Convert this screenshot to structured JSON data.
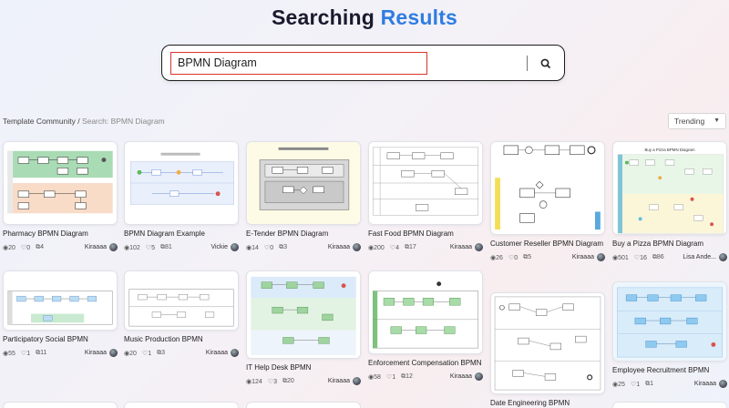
{
  "header": {
    "title_part1": "Searching",
    "title_part2": "Results"
  },
  "search": {
    "value": "BPMN Diagram",
    "button": "search-icon"
  },
  "breadcrumb": {
    "root": "Template Community",
    "separator": " / ",
    "current": "Search: BPMN Diagram"
  },
  "sort": {
    "selected": "Trending",
    "icon": "chevron-down-icon"
  },
  "colors": {
    "accent": "#2f7de1",
    "search_border": "#d9342b",
    "title": "#1a1a2e"
  },
  "cards": [
    {
      "title": "Pharmacy BPMN Diagram",
      "views": "20",
      "likes": "0",
      "copies": "4",
      "author": "Kiraaaa"
    },
    {
      "title": "BPMN Diagram Example",
      "views": "102",
      "likes": "5",
      "copies": "81",
      "author": "Vickie"
    },
    {
      "title": "E-Tender BPMN Diagram",
      "views": "14",
      "likes": "0",
      "copies": "3",
      "author": "Kiraaaa"
    },
    {
      "title": "Fast Food BPMN Diagram",
      "views": "200",
      "likes": "4",
      "copies": "17",
      "author": "Kiraaaa"
    },
    {
      "title": "Customer Reseller BPMN Diagram",
      "views": "26",
      "likes": "0",
      "copies": "5",
      "author": "Kiraaaa"
    },
    {
      "title": "Buy a Pizza BPMN Diagram",
      "views": "501",
      "likes": "16",
      "copies": "86",
      "author": "Lisa Ande..."
    },
    {
      "title": "Participatory Social BPMN",
      "views": "55",
      "likes": "1",
      "copies": "11",
      "author": "Kiraaaa"
    },
    {
      "title": "Music Production BPMN",
      "views": "20",
      "likes": "1",
      "copies": "3",
      "author": "Kiraaaa"
    },
    {
      "title": "IT Help Desk BPMN",
      "views": "124",
      "likes": "3",
      "copies": "20",
      "author": "Kiraaaa"
    },
    {
      "title": "Enforcement Compensation BPMN",
      "views": "58",
      "likes": "1",
      "copies": "12",
      "author": "Kiraaaa"
    },
    {
      "title": "Date Engineering BPMN",
      "views": "",
      "likes": "",
      "copies": "",
      "author": ""
    },
    {
      "title": "Employee Recruitment BPMN",
      "views": "25",
      "likes": "1",
      "copies": "1",
      "author": "Kiraaaa"
    }
  ],
  "thumbs": {
    "pizza_title": "Buy a Pizza BPMN Diagram"
  },
  "icons": {
    "views": "eye-icon",
    "likes": "heart-icon",
    "copies": "copy-icon"
  }
}
